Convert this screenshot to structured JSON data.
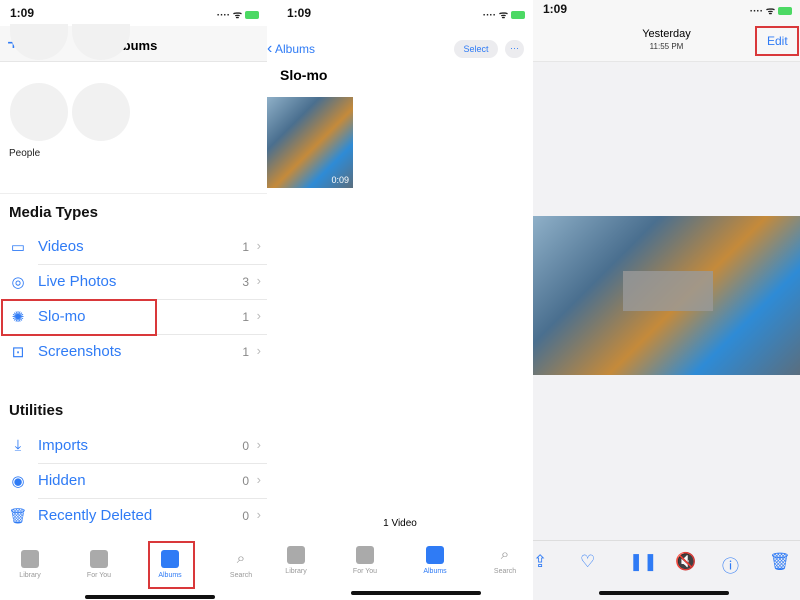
{
  "status": {
    "time": "1:09"
  },
  "albums": {
    "title": "Albums",
    "add_label": "+",
    "people_label": "People",
    "media_types_title": "Media Types",
    "media_types": [
      {
        "label": "Videos",
        "count": "1",
        "icon": "video-icon"
      },
      {
        "label": "Live Photos",
        "count": "3",
        "icon": "live-photo-icon"
      },
      {
        "label": "Slo-mo",
        "count": "1",
        "icon": "slomo-icon"
      },
      {
        "label": "Screenshots",
        "count": "1",
        "icon": "screenshot-icon"
      }
    ],
    "utilities_title": "Utilities",
    "utilities": [
      {
        "label": "Imports",
        "count": "0",
        "icon": "import-icon"
      },
      {
        "label": "Hidden",
        "count": "0",
        "icon": "hidden-eye-icon"
      },
      {
        "label": "Recently Deleted",
        "count": "0",
        "icon": "trash-icon"
      }
    ]
  },
  "tabs": [
    {
      "label": "Library"
    },
    {
      "label": "For You"
    },
    {
      "label": "Albums"
    },
    {
      "label": "Search"
    }
  ],
  "slomo": {
    "back_label": "Albums",
    "select_label": "Select",
    "more_label": "···",
    "title": "Slo-mo",
    "video_duration": "0:09",
    "footer": "1 Video"
  },
  "viewer": {
    "date": "Yesterday",
    "time": "11:55 PM",
    "edit_label": "Edit"
  },
  "colors": {
    "accent": "#2f7bf5",
    "highlight": "#d9383a"
  }
}
